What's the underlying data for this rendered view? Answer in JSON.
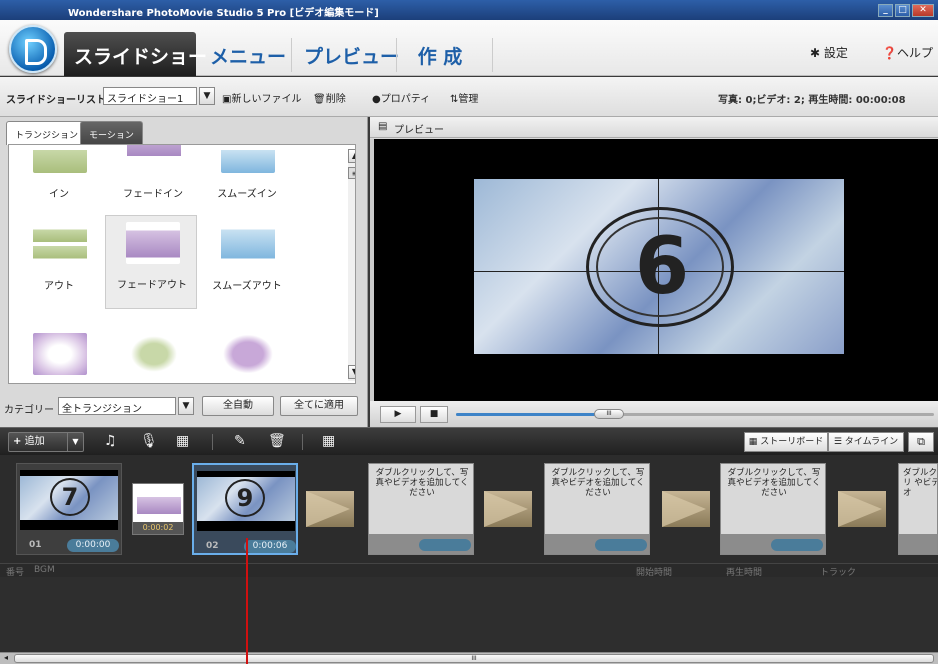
{
  "window": {
    "title": "Wondershare PhotoMovie Studio 5 Pro [ビデオ編集モード]"
  },
  "nav": {
    "tabs": [
      {
        "label": "スライドショー"
      },
      {
        "label": "メニュー"
      },
      {
        "label": "プレビュー"
      },
      {
        "label": "作 成"
      }
    ],
    "settings": "設定",
    "help": "ヘルプ"
  },
  "toolbar": {
    "slideshow_list_label": "スライドショーリスト",
    "slideshow_select": "スライドショー1",
    "new_file": "新しいファイル",
    "delete": "削除",
    "properties": "プロパティ",
    "manage": "管理",
    "info": "写真: 0;ビデオ: 2; 再生時間: 00:00:08"
  },
  "left_panel": {
    "tabs": [
      {
        "label": "トランジション"
      },
      {
        "label": "モーション"
      }
    ],
    "transitions": [
      {
        "label": "イン"
      },
      {
        "label": "フェードイン"
      },
      {
        "label": "スムーズイン"
      },
      {
        "label": "アウト"
      },
      {
        "label": "フェードアウト"
      },
      {
        "label": "スムーズアウト"
      },
      {
        "label": ""
      },
      {
        "label": ""
      },
      {
        "label": ""
      }
    ],
    "category_label": "カテゴリー",
    "category_value": "全トランジション",
    "auto_button": "全自動",
    "apply_all_button": "全てに適用"
  },
  "preview": {
    "header": "プレビュー",
    "countdown_number": "6",
    "progress": 0.32
  },
  "bottom_toolbar": {
    "add_button": "追加",
    "storyboard": "ストーリボード",
    "timeline": "タイムライン"
  },
  "storyboard": {
    "clips": [
      {
        "number": "01",
        "duration": "0:00:00",
        "digit": "7"
      },
      {
        "number": "02",
        "duration": "0:00:06",
        "digit": "9"
      }
    ],
    "transition_duration": "0:00:02",
    "empty_slot_text": "ダブルクリックして、写真やビデオを追加してください",
    "partial_slot_text": "ダブルクリ やビデオ"
  },
  "bgm": {
    "columns": [
      "番号",
      "BGM",
      "開始時間",
      "再生時間",
      "トラック"
    ]
  },
  "scrollbar": {
    "thumb_label": "III"
  }
}
